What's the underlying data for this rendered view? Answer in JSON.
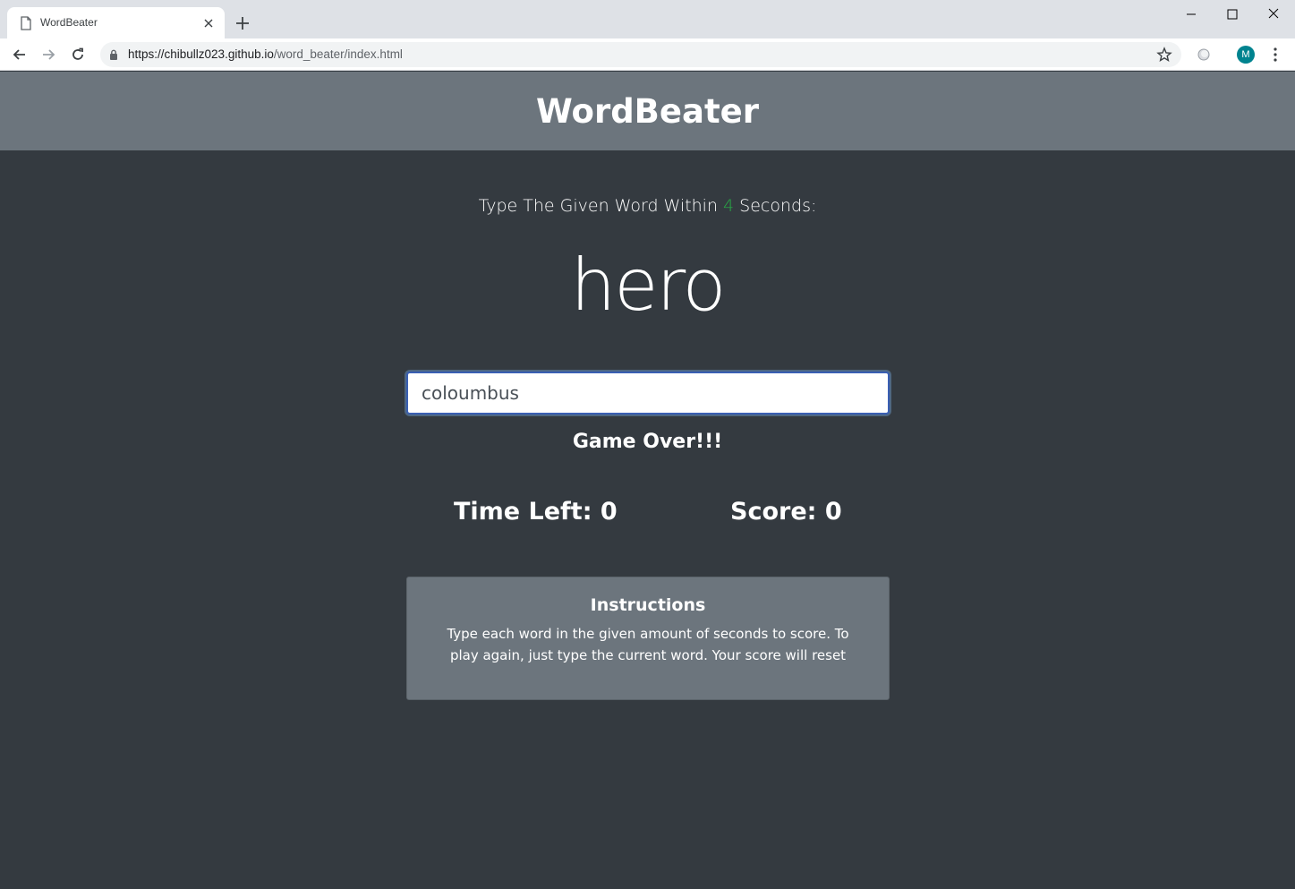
{
  "browser": {
    "tab_title": "WordBeater",
    "url_host": "https://chibullz023.github.io",
    "url_path": "/word_beater/index.html",
    "avatar_letter": "M"
  },
  "header": {
    "title": "WordBeater"
  },
  "game": {
    "lead_prefix": "Type The Given Word Within ",
    "seconds": "4",
    "lead_suffix": " Seconds:",
    "current_word": "hero",
    "input_value": "coloumbus",
    "message": "Game Over!!!",
    "time_left_label": "Time Left: ",
    "time_left": "0",
    "score_label": "Score: ",
    "score": "0"
  },
  "instructions": {
    "title": "Instructions",
    "text": "Type each word in the given amount of seconds to score. To play again, just type the current word. Your score will reset"
  },
  "colors": {
    "header_bg": "#6c757d",
    "page_bg": "#343a40",
    "seconds_accent": "#28a745",
    "avatar_bg": "#00838f"
  }
}
